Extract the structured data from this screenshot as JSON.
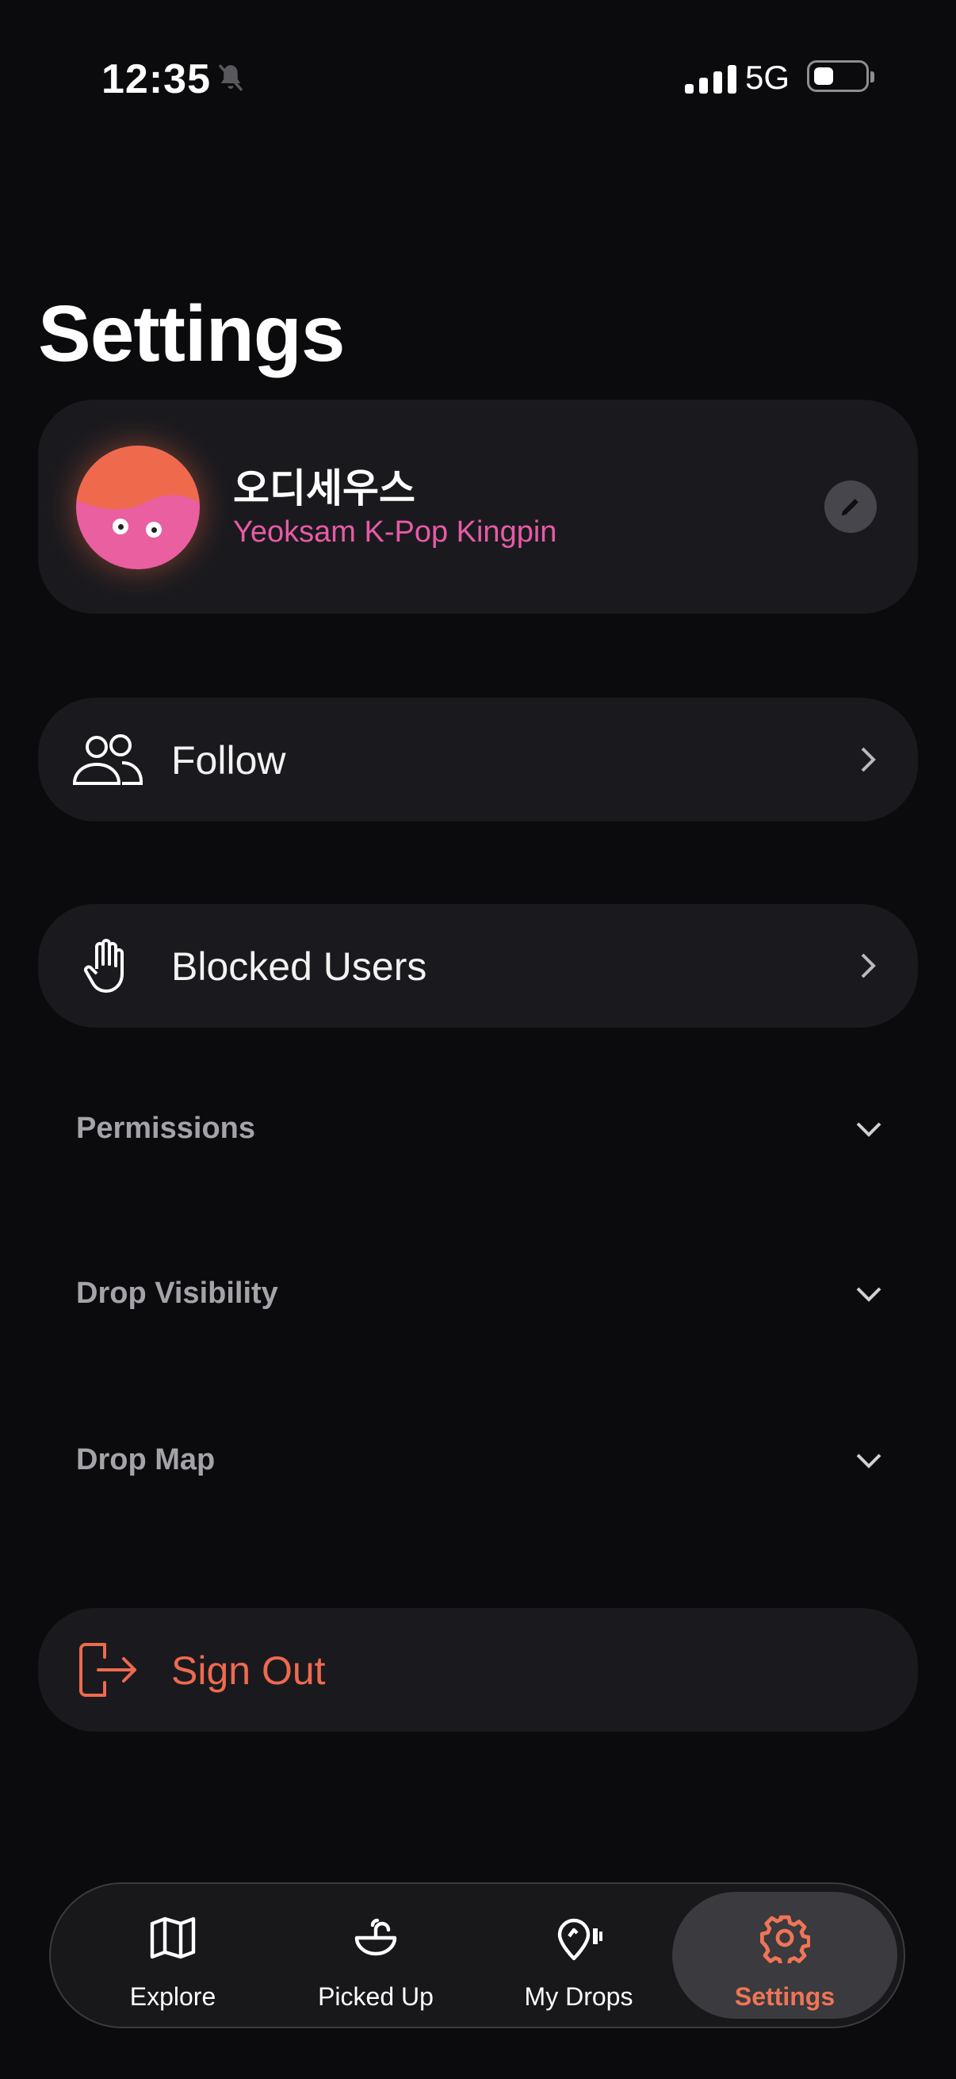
{
  "status_bar": {
    "time": "12:35",
    "network": "5G",
    "battery_level": 0.25
  },
  "page": {
    "title": "Settings"
  },
  "profile": {
    "name": "오디세우스",
    "subtitle": "Yeoksam K-Pop Kingpin",
    "subtitle_color": "#e85aa6",
    "edit_icon": "pencil-icon"
  },
  "menu": {
    "follow": {
      "label": "Follow",
      "icon": "people-icon"
    },
    "blocked": {
      "label": "Blocked Users",
      "icon": "hand-icon"
    }
  },
  "sections": [
    {
      "title": "Permissions"
    },
    {
      "title": "Drop Visibility"
    },
    {
      "title": "Drop Map"
    }
  ],
  "sign_out": {
    "label": "Sign Out",
    "icon": "sign-out-icon",
    "color": "#ee6a4f"
  },
  "tabs": [
    {
      "label": "Explore",
      "icon": "map-icon",
      "active": false
    },
    {
      "label": "Picked Up",
      "icon": "bowl-icon",
      "active": false
    },
    {
      "label": "My Drops",
      "icon": "pin-icon",
      "active": false
    },
    {
      "label": "Settings",
      "icon": "gear-icon",
      "active": true
    }
  ],
  "accent_color": "#ef7556"
}
